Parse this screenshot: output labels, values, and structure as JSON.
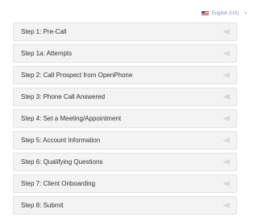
{
  "language": {
    "label": "English (US)",
    "icon": "us-flag-icon"
  },
  "steps": [
    {
      "label": "Step 1: Pre-Call"
    },
    {
      "label": "Step 1a: Attempts"
    },
    {
      "label": "Step 2: Call Prospect from OpenPhone"
    },
    {
      "label": "Step 3: Phone Call Answered"
    },
    {
      "label": "Step 4: Set a Meeting/Appointment"
    },
    {
      "label": "Step 5: Account Information"
    },
    {
      "label": "Step 6: Qualifying Questions"
    },
    {
      "label": "Step 7: Client Onboarding"
    },
    {
      "label": "Step 8: Submit"
    }
  ],
  "colors": {
    "panel_bg": "#f3f3f3",
    "panel_border": "#e3e3e3",
    "text": "#333333",
    "toggle_icon": "#d8d8d8"
  }
}
